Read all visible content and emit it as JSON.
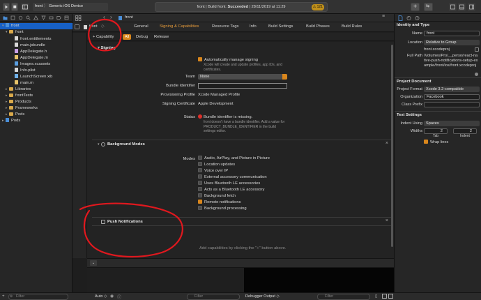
{
  "toolbar": {
    "scheme_project": "front",
    "scheme_device": "Generic iOS Device",
    "status_prefix": "front | Build front: ",
    "status_result": "Succeeded",
    "status_date": " | 28/11/2019 at 11:29",
    "warning_count": "121"
  },
  "navigator": {
    "items": [
      {
        "label": "front"
      },
      {
        "label": "front"
      },
      {
        "label": "front.entitlements"
      },
      {
        "label": "main.jsbundle"
      },
      {
        "label": "AppDelegate.h"
      },
      {
        "label": "AppDelegate.m"
      },
      {
        "label": "Images.xcassets"
      },
      {
        "label": "Info.plist"
      },
      {
        "label": "LaunchScreen.xib"
      },
      {
        "label": "main.m"
      },
      {
        "label": "Libraries"
      },
      {
        "label": "frontTests"
      },
      {
        "label": "Products"
      },
      {
        "label": "Frameworks"
      },
      {
        "label": "Pods"
      },
      {
        "label": "Pods"
      }
    ],
    "filter_placeholder": "Filter"
  },
  "editor": {
    "breadcrumb": "front",
    "target_name": "front",
    "tabs": [
      "General",
      "Signing & Capabilities",
      "Resource Tags",
      "Info",
      "Build Settings",
      "Build Phases",
      "Build Rules"
    ],
    "capability_button": "+ Capability",
    "config_tabs": [
      "All",
      "Debug",
      "Release"
    ],
    "signing": {
      "section_title": "Signing",
      "auto_manage": "Automatically manage signing",
      "auto_manage_note": "Xcode will create and update profiles, app IDs, and certificates.",
      "team_label": "Team",
      "team_value": "None",
      "bundle_id_label": "Bundle Identifier",
      "bundle_id_value": "",
      "prov_label": "Provisioning Profile",
      "prov_value": "Xcode Managed Profile",
      "cert_label": "Signing Certificate",
      "cert_value": "Apple Development",
      "status_label": "Status",
      "status_error": "Bundle identifier is missing.",
      "status_detail": "front doesn't have a bundle identifier. Add a value for PRODUCT_BUNDLE_IDENTIFIER in the build settings editor."
    },
    "background_modes": {
      "section_title": "Background Modes",
      "modes_label": "Modes",
      "options": [
        {
          "label": "Audio, AirPlay, and Picture in Picture",
          "checked": false
        },
        {
          "label": "Location updates",
          "checked": false
        },
        {
          "label": "Voice over IP",
          "checked": false
        },
        {
          "label": "External accessory communication",
          "checked": false
        },
        {
          "label": "Uses Bluetooth LE accessories",
          "checked": false
        },
        {
          "label": "Acts as a Bluetooth LE accessory",
          "checked": false
        },
        {
          "label": "Background fetch",
          "checked": false
        },
        {
          "label": "Remote notifications",
          "checked": true
        },
        {
          "label": "Background processing",
          "checked": false
        }
      ]
    },
    "push": {
      "section_title": "Push Notifications"
    },
    "hint": "Add capabilities by clicking the \"+\" button above."
  },
  "debug": {
    "auto_label": "Auto",
    "filter_placeholder": "Filter",
    "output_label": "Debugger Output"
  },
  "inspector": {
    "identity_header": "Identity and Type",
    "name_label": "Name",
    "name_value": "front",
    "location_label": "Location",
    "location_value": "Relative to Group",
    "file_name": "front.xcodeproj",
    "full_path_label": "Full Path",
    "full_path_value": "/Volumes/Pro/__perso/react-native-push-notifications-setup-example/front/ios/front.xcodeproj",
    "project_doc_header": "Project Document",
    "format_label": "Project Format",
    "format_value": "Xcode 3.2-compatible",
    "org_label": "Organization",
    "org_value": "Facebook",
    "prefix_label": "Class Prefix",
    "prefix_value": "",
    "text_settings_header": "Text Settings",
    "indent_label": "Indent Using",
    "indent_value": "Spaces",
    "widths_label": "Widths",
    "tab_value": "2",
    "indent_width_value": "2",
    "tab_caption": "Tab",
    "indent_caption": "Indent",
    "wrap_label": "Wrap lines"
  },
  "colors": {
    "accent": "#d9861c",
    "annotation": "#e0181e",
    "error": "#e0302a"
  }
}
